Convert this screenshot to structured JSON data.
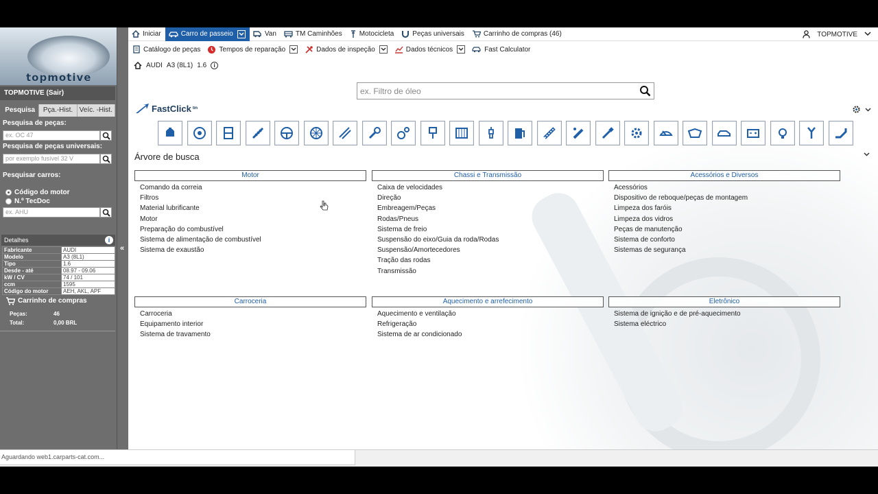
{
  "sidebar": {
    "logo_text": "topmotive",
    "user_title": "TOPMOTIVE (Sair)",
    "tabs": [
      "Pesquisa",
      "Pça.-Hist.",
      "Veíc. -Hist."
    ],
    "parts_search_label": "Pesquisa de peças:",
    "parts_search_placeholder": "ex. OC 47",
    "universal_search_label": "Pesquisa de peças universais:",
    "universal_search_placeholder": "por exemplo fusível 32 V",
    "car_search_label": "Pesquisar carros:",
    "radio_engine_code": "Código do motor",
    "radio_tecdoc": "N.º TecDoc",
    "car_search_placeholder": "ex. AHU",
    "details_title": "Detalhes",
    "details": [
      {
        "k": "Fabricante",
        "v": "AUDI"
      },
      {
        "k": "Modelo",
        "v": "A3 (8L1)"
      },
      {
        "k": "Tipo",
        "v": "1.6"
      },
      {
        "k": "Desde - até",
        "v": "08.97 - 09.06"
      },
      {
        "k": "kW / CV",
        "v": "74 / 101"
      },
      {
        "k": "ccm",
        "v": "1595"
      },
      {
        "k": "Código do motor",
        "v": "AEH, AKL, APF"
      }
    ],
    "cart_title": "Carrinho de compras",
    "cart_items_label": "Peças:",
    "cart_items_value": "46",
    "cart_total_label": "Total:",
    "cart_total_value": "0,00 BRL"
  },
  "nav1": {
    "home": "Iniciar",
    "car": "Carro de passeio",
    "van": "Van",
    "truck": "TM Caminhões",
    "moto": "Motocicleta",
    "universal": "Peças universais",
    "cart": "Carrinho de compras (46)",
    "user": "TOPMOTIVE"
  },
  "nav2": {
    "catalog": "Catálogo de peças",
    "repair_times": "Tempos de reparação",
    "inspection": "Dados de inspeção",
    "technical": "Dados técnicos",
    "fast_calc": "Fast Calculator"
  },
  "vehicle": {
    "make": "AUDI",
    "model": "A3 (8L1)",
    "engine": "1.6"
  },
  "filter": {
    "placeholder": "ex. Filtro de óleo"
  },
  "fastclick": {
    "label": "FastClick",
    "sup": "tm"
  },
  "icons": [
    "oil-can-icon",
    "brake-disc-icon",
    "chassis-icon",
    "shock-absorber-icon",
    "steering-wheel-icon",
    "wheel-icon",
    "belt-icon",
    "wrench-icon",
    "pulley-icon",
    "piston-icon",
    "radiator-icon",
    "spark-plug-icon",
    "fuel-pump-icon",
    "chain-icon",
    "tool-icon",
    "brush-icon",
    "gear-icon",
    "wiper-icon",
    "windshield-icon",
    "car-body-icon",
    "battery-icon",
    "bulb-icon",
    "suspension-icon",
    "exhaust-icon"
  ],
  "search_tree": {
    "title": "Árvore de busca",
    "categories": [
      {
        "title": "Motor",
        "items": [
          "Comando da correia",
          "Filtros",
          "Material lubrificante",
          "Motor",
          "Preparação do combustível",
          "Sistema de alimentação de combustível",
          "Sistema de exaustão"
        ]
      },
      {
        "title": "Chassi e Transmissão",
        "items": [
          "Caixa de velocidades",
          "Direção",
          "Embreagem/Peças",
          "Rodas/Pneus",
          "Sistema de freio",
          "Suspensão do eixo/Guia da roda/Rodas",
          "Suspensão/Amortecedores",
          "Tração das rodas",
          "Transmissão"
        ]
      },
      {
        "title": "Acessórios e Diversos",
        "items": [
          "Acessórios",
          "Dispositivo de reboque/peças de montagem",
          "Limpeza dos faróis",
          "Limpeza dos vidros",
          "Peças de manutenção",
          "Sistema de conforto",
          "Sistemas de segurança"
        ]
      },
      {
        "title": "Carroceria",
        "items": [
          "Carroceria",
          "Equipamento interior",
          "Sistema de travamento"
        ]
      },
      {
        "title": "Aquecimento e arrefecimento",
        "items": [
          "Aquecimento e ventilação",
          "Refrigeração",
          "Sistema de ar condicionado"
        ]
      },
      {
        "title": "Eletrônico",
        "items": [
          "Sistema de ignição e de pré-aquecimento",
          "Sistema eléctrico"
        ]
      }
    ]
  },
  "status_text": "Aguardando web1.carparts-cat.com..."
}
